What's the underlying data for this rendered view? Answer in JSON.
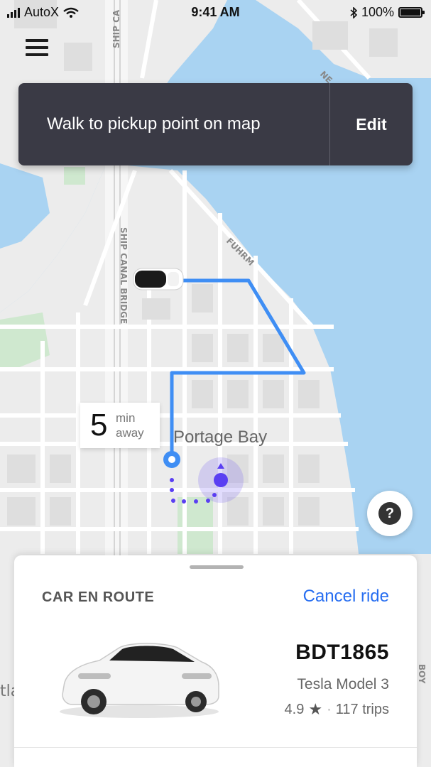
{
  "status_bar": {
    "carrier": "AutoX",
    "time": "9:41 AM",
    "battery": "100%",
    "signal_icon": "signal-bars-icon",
    "wifi_icon": "wifi-icon",
    "bluetooth_icon": "bluetooth-icon",
    "battery_icon": "battery-icon"
  },
  "map": {
    "street_labels": [
      "SHIP CANAL BRIDGE",
      "SHIP CA",
      "FUHRM",
      "NE",
      "BOY"
    ],
    "place_label": "Portage Bay",
    "partial_label": "tla",
    "colors": {
      "water": "#a9d3f2",
      "land": "#ececec",
      "park": "#cfe8cf",
      "route": "#3f8ef4",
      "walk": "#5a3ff2"
    }
  },
  "banner": {
    "message": "Walk to pickup point on map",
    "edit_label": "Edit"
  },
  "eta": {
    "value": "5",
    "unit": "min",
    "suffix": "away"
  },
  "help": {
    "label": "?"
  },
  "sheet": {
    "status": "CAR EN ROUTE",
    "cancel_label": "Cancel ride",
    "plate": "BDT1865",
    "model": "Tesla Model 3",
    "rating": "4.9",
    "star": "★",
    "separator": "·",
    "trips": "117 trips",
    "accent_color": "#276ef1"
  }
}
